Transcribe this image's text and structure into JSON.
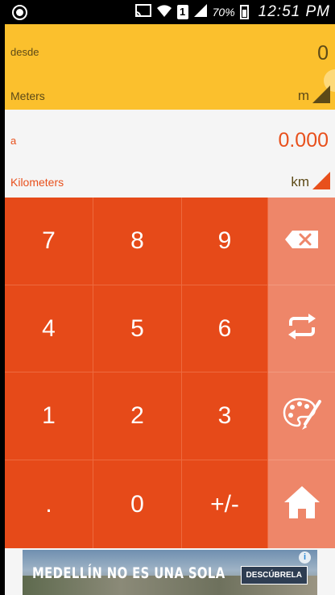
{
  "status_bar": {
    "battery_percent": "70%",
    "time": "12:51 PM",
    "sim_label": "1",
    "icons": [
      "screen-record-icon",
      "cast-icon",
      "wifi-icon",
      "sim-icon",
      "signal-icon",
      "battery-icon"
    ]
  },
  "from": {
    "label": "desde",
    "value": "0",
    "unit_name": "Meters",
    "unit_abbr": "m"
  },
  "to": {
    "label": "a",
    "value": "0.000",
    "unit_name": "Kilometers",
    "unit_abbr": "km"
  },
  "keypad": {
    "keys": [
      "7",
      "8",
      "9",
      "4",
      "5",
      "6",
      "1",
      "2",
      "3",
      ".",
      "0",
      "+/-"
    ],
    "side_icons": [
      "backspace-icon",
      "swap-icon",
      "palette-icon",
      "home-icon"
    ]
  },
  "ad": {
    "text": "MEDELLÍN NO ES UNA SOLA",
    "cta": "DESCÚBRELA",
    "info": "i",
    "close": "×"
  },
  "colors": {
    "from_bg": "#fbc02d",
    "to_accent": "#e8501c",
    "keypad_bg": "#e64a19",
    "side_col_bg": "#ee8669"
  }
}
